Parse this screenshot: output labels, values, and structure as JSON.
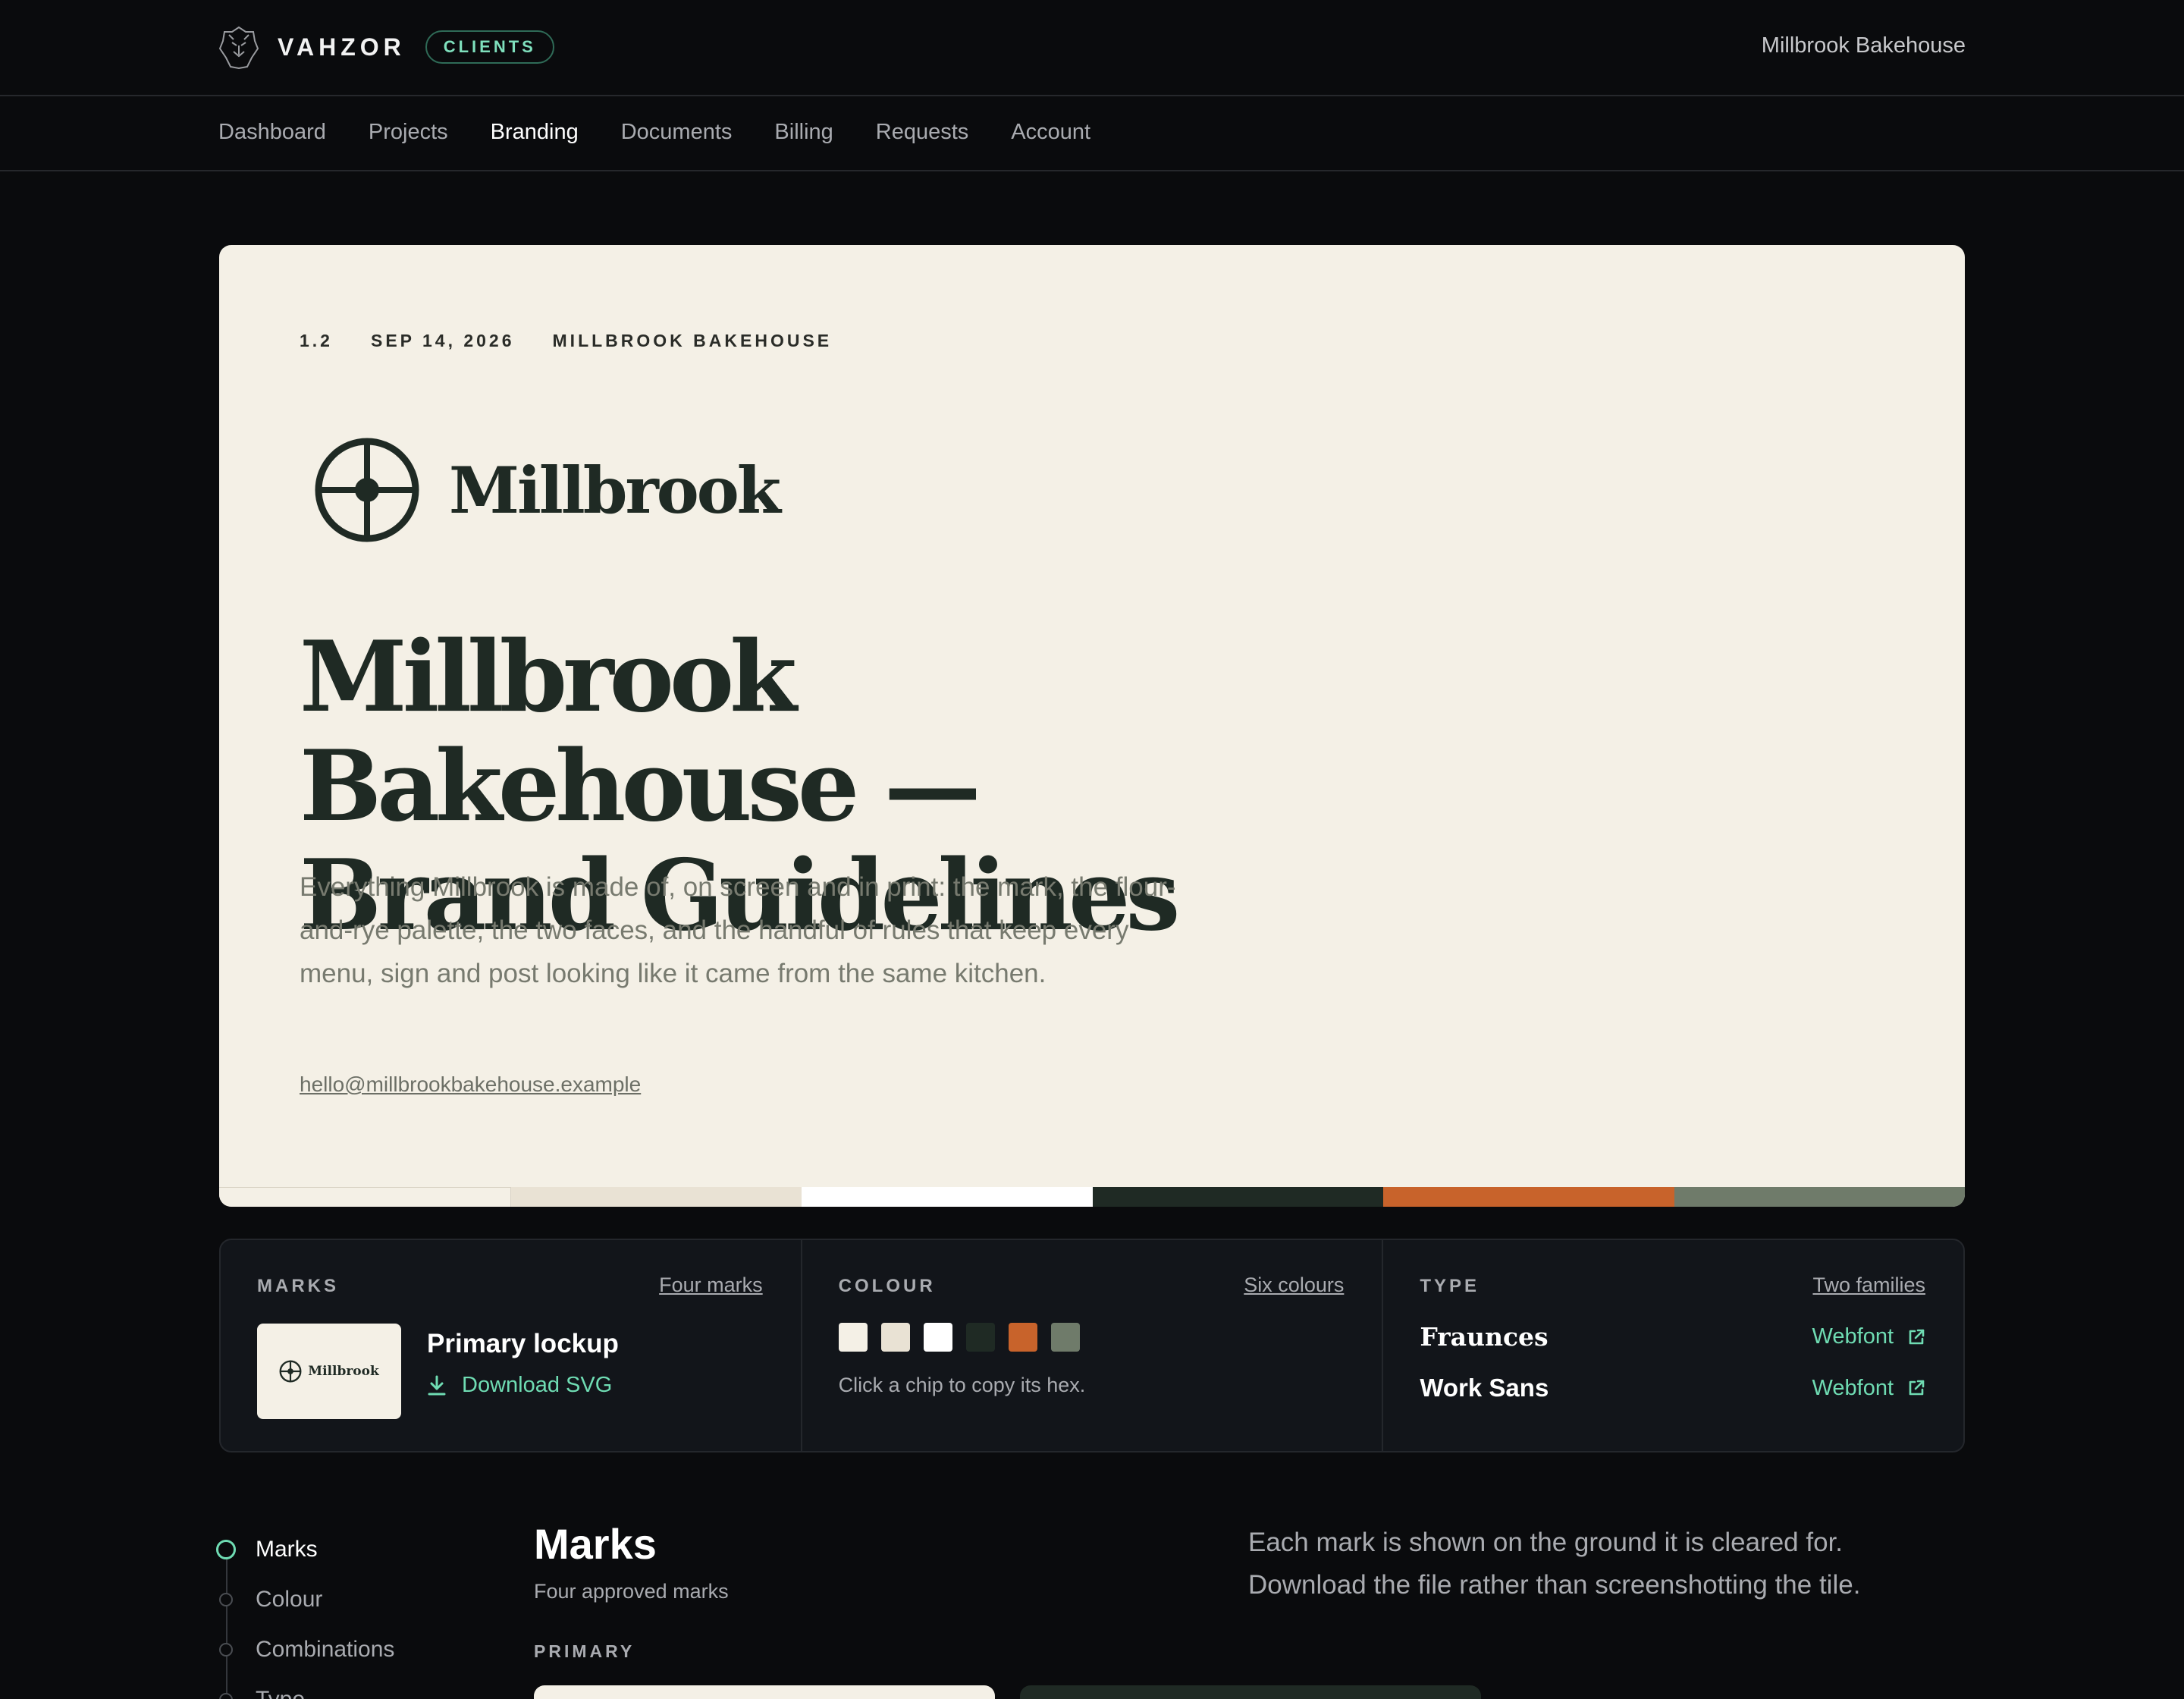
{
  "app": {
    "brand": "VAHZOR",
    "badge": "CLIENTS",
    "client_name": "Millbrook Bakehouse"
  },
  "nav": {
    "items": [
      "Dashboard",
      "Projects",
      "Branding",
      "Documents",
      "Billing",
      "Requests",
      "Account"
    ],
    "active": "Branding"
  },
  "hero": {
    "version": "1.2",
    "date": "SEP 14, 2026",
    "client": "MILLBROOK BAKEHOUSE",
    "lockup_name": "Millbrook",
    "title": "Millbrook Bakehouse — Brand Guidelines",
    "description": "Everything Millbrook is made of, on screen and in print: the mark, the flour-and-rye palette, the two faces, and the handful of rules that keep every menu, sign and post looking like it came from the same kitchen.",
    "email": "hello@millbrookbakehouse.example",
    "palette": [
      "#f4f0e6",
      "#e9e2d4",
      "#ffffff",
      "#1f2a24",
      "#c8632b",
      "#6f7b6a"
    ]
  },
  "summary": {
    "marks": {
      "label": "MARKS",
      "link": "Four marks",
      "thumb_name": "Millbrook",
      "title": "Primary lockup",
      "download": "Download SVG"
    },
    "colour": {
      "label": "COLOUR",
      "link": "Six colours",
      "chips": [
        "#f4f0e6",
        "#e9e2d4",
        "#ffffff",
        "#1f2a24",
        "#c8632b",
        "#6f7b6a"
      ],
      "hint": "Click a chip to copy its hex."
    },
    "type": {
      "label": "TYPE",
      "link": "Two families",
      "fonts": [
        {
          "name": "Fraunces",
          "link": "Webfont"
        },
        {
          "name": "Work Sans",
          "link": "Webfont"
        }
      ]
    }
  },
  "toc": {
    "items": [
      "Marks",
      "Colour",
      "Combinations",
      "Type"
    ],
    "active": "Marks"
  },
  "section": {
    "title": "Marks",
    "subtitle": "Four approved marks",
    "group": "PRIMARY",
    "note": "Each mark is shown on the ground it is cleared for. Download the file rather than screenshotting the tile."
  }
}
